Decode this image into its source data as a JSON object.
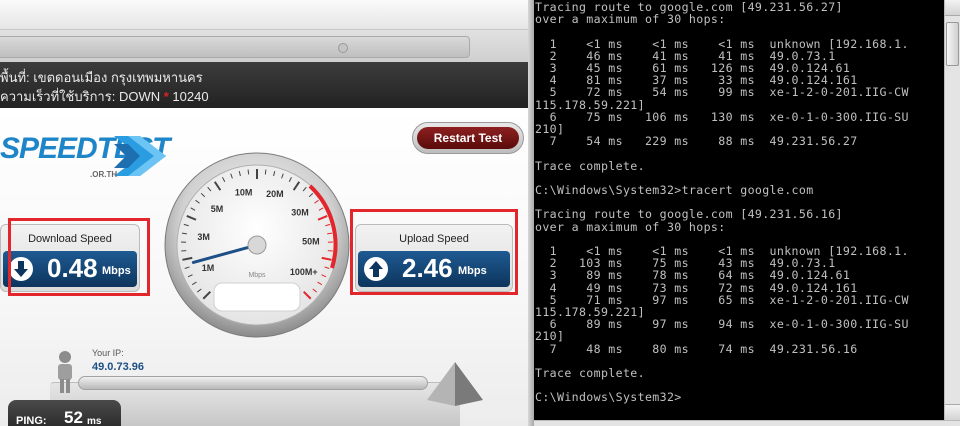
{
  "info": {
    "area_label": "พื้นที่: เขตดอนเมือง กรุงเทพมหานคร",
    "speed_label": "ความเร็วที่ใช้บริการ: DOWN",
    "speed_star": "*",
    "speed_value": "10240"
  },
  "logo": {
    "text": "SPEEDTEST",
    "sub": ".OR.TH"
  },
  "restart_label": "Restart Test",
  "download": {
    "label": "Download Speed",
    "value": "0.48",
    "unit": "Mbps"
  },
  "upload": {
    "label": "Upload Speed",
    "value": "2.46",
    "unit": "Mbps"
  },
  "gauge": {
    "ticks": [
      "1M",
      "3M",
      "5M",
      "10M",
      "20M",
      "30M",
      "50M",
      "100M+"
    ],
    "unit": "Mbps",
    "value_fraction": 0.11
  },
  "ip": {
    "label": "Your IP:",
    "value": "49.0.73.96"
  },
  "ping": {
    "label": "PING:",
    "value": "52",
    "unit": "ms"
  },
  "console_lines": [
    "Tracing route to google.com [49.231.56.27]",
    "over a maximum of 30 hops:",
    "",
    "  1    <1 ms    <1 ms    <1 ms  unknown [192.168.1.",
    "  2    46 ms    41 ms    41 ms  49.0.73.1",
    "  3    45 ms    61 ms   126 ms  49.0.124.61",
    "  4    81 ms    37 ms    33 ms  49.0.124.161",
    "  5    72 ms    54 ms    99 ms  xe-1-2-0-201.IIG-CW",
    "115.178.59.221]",
    "  6    75 ms   106 ms   130 ms  xe-0-1-0-300.IIG-SU",
    "210]",
    "  7    54 ms   229 ms    88 ms  49.231.56.27",
    "",
    "Trace complete.",
    "",
    "C:\\Windows\\System32>tracert google.com",
    "",
    "Tracing route to google.com [49.231.56.16]",
    "over a maximum of 30 hops:",
    "",
    "  1    <1 ms    <1 ms    <1 ms  unknown [192.168.1.",
    "  2   103 ms    75 ms    43 ms  49.0.73.1",
    "  3    89 ms    78 ms    64 ms  49.0.124.61",
    "  4    49 ms    73 ms    72 ms  49.0.124.161",
    "  5    71 ms    97 ms    65 ms  xe-1-2-0-201.IIG-CW",
    "115.178.59.221]",
    "  6    89 ms    97 ms    94 ms  xe-0-1-0-300.IIG-SU",
    "210]",
    "  7    48 ms    80 ms    74 ms  49.231.56.16",
    "",
    "Trace complete.",
    "",
    "C:\\Windows\\System32>"
  ],
  "colors": {
    "highlight_box": "#e3262b",
    "speed_panel": "#0d355d",
    "console_text": "#c0c0c0"
  }
}
